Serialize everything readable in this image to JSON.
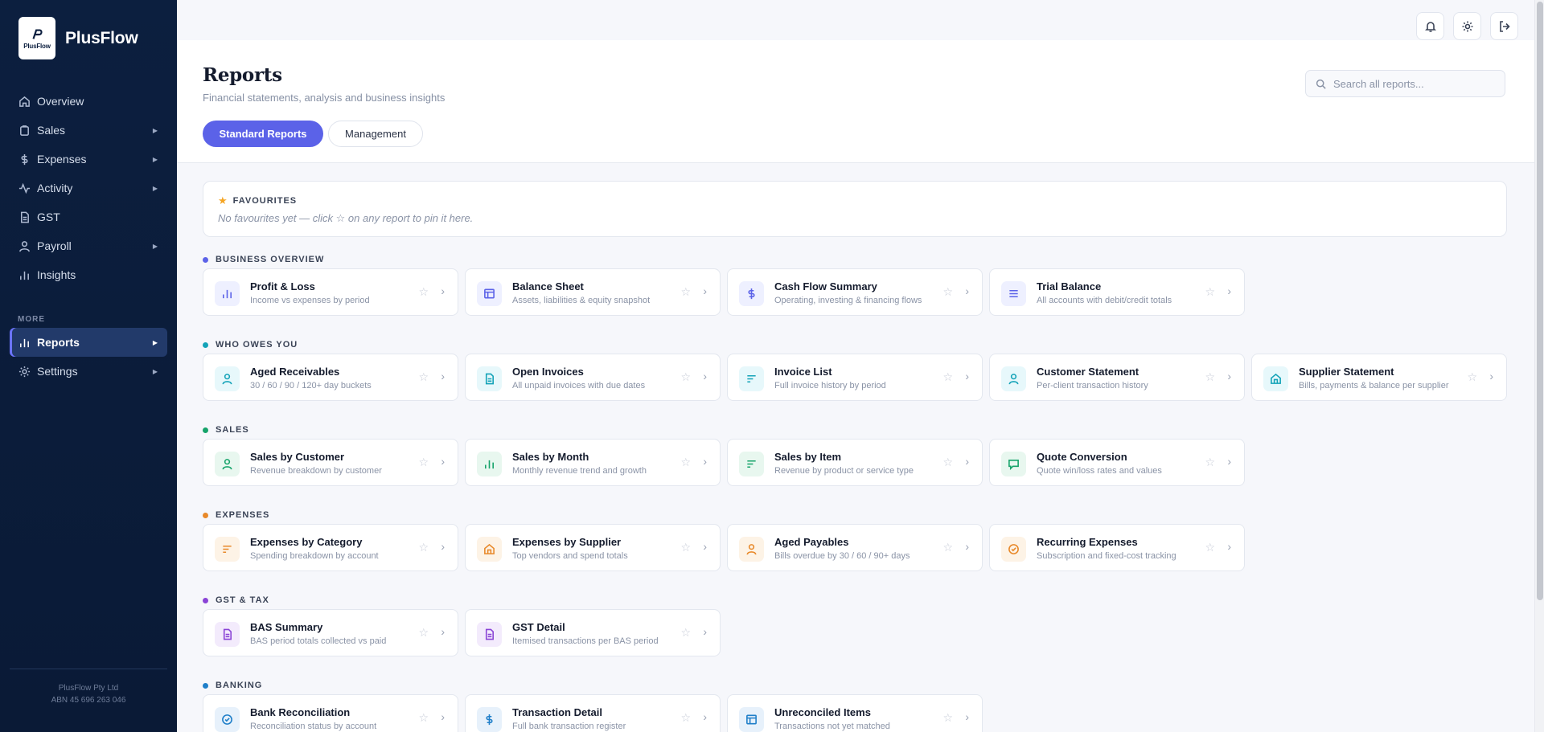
{
  "app": {
    "name": "PlusFlow",
    "logo_text": "PlusFlow",
    "company_name": "PlusFlow Pty Ltd",
    "abn": "ABN 45 696 263 046"
  },
  "sidebar": {
    "items": [
      {
        "label": "Overview",
        "icon": "home-icon"
      },
      {
        "label": "Sales",
        "icon": "clipboard-icon"
      },
      {
        "label": "Expenses",
        "icon": "dollar-icon"
      },
      {
        "label": "Activity",
        "icon": "activity-icon"
      },
      {
        "label": "GST",
        "icon": "document-icon"
      },
      {
        "label": "Payroll",
        "icon": "person-icon"
      },
      {
        "label": "Insights",
        "icon": "bar-chart-icon"
      }
    ],
    "more_label": "MORE",
    "more_items": [
      {
        "label": "Reports",
        "icon": "bar-chart-icon",
        "active": true
      },
      {
        "label": "Settings",
        "icon": "gear-icon"
      }
    ]
  },
  "header": {
    "title": "Reports",
    "subtitle": "Financial statements, analysis and business insights",
    "tabs": [
      {
        "label": "Standard Reports",
        "active": true
      },
      {
        "label": "Management",
        "active": false
      }
    ],
    "search_placeholder": "Search all reports..."
  },
  "favourites": {
    "title": "FAVOURITES",
    "empty_text": "No favourites yet — click ☆ on any report to pin it here."
  },
  "sections": [
    {
      "label": "BUSINESS OVERVIEW",
      "color": "#5b62e8",
      "cards": [
        {
          "title": "Profit & Loss",
          "desc": "Income vs expenses by period",
          "icon": "bar-chart-icon"
        },
        {
          "title": "Balance Sheet",
          "desc": "Assets, liabilities & equity snapshot",
          "icon": "table-icon"
        },
        {
          "title": "Cash Flow Summary",
          "desc": "Operating, investing & financing flows",
          "icon": "dollar-icon"
        },
        {
          "title": "Trial Balance",
          "desc": "All accounts with debit/credit totals",
          "icon": "list-icon"
        }
      ]
    },
    {
      "label": "WHO OWES YOU",
      "color": "#14a3b8",
      "cards": [
        {
          "title": "Aged Receivables",
          "desc": "30 / 60 / 90 / 120+ day buckets",
          "icon": "person-icon"
        },
        {
          "title": "Open Invoices",
          "desc": "All unpaid invoices with due dates",
          "icon": "document-icon"
        },
        {
          "title": "Invoice List",
          "desc": "Full invoice history by period",
          "icon": "sort-icon"
        },
        {
          "title": "Customer Statement",
          "desc": "Per-client transaction history",
          "icon": "person-icon"
        },
        {
          "title": "Supplier Statement",
          "desc": "Bills, payments & balance per supplier",
          "icon": "building-icon"
        }
      ]
    },
    {
      "label": "SALES",
      "color": "#16a36a",
      "cards": [
        {
          "title": "Sales by Customer",
          "desc": "Revenue breakdown by customer",
          "icon": "person-icon"
        },
        {
          "title": "Sales by Month",
          "desc": "Monthly revenue trend and growth",
          "icon": "bar-chart-icon"
        },
        {
          "title": "Sales by Item",
          "desc": "Revenue by product or service type",
          "icon": "sort-icon"
        },
        {
          "title": "Quote Conversion",
          "desc": "Quote win/loss rates and values",
          "icon": "chat-icon"
        }
      ]
    },
    {
      "label": "EXPENSES",
      "color": "#e8892a",
      "cards": [
        {
          "title": "Expenses by Category",
          "desc": "Spending breakdown by account",
          "icon": "sort-icon"
        },
        {
          "title": "Expenses by Supplier",
          "desc": "Top vendors and spend totals",
          "icon": "building-icon"
        },
        {
          "title": "Aged Payables",
          "desc": "Bills overdue by 30 / 60 / 90+ days",
          "icon": "person-icon"
        },
        {
          "title": "Recurring Expenses",
          "desc": "Subscription and fixed-cost tracking",
          "icon": "check-circle-icon"
        }
      ]
    },
    {
      "label": "GST & TAX",
      "color": "#8a44d6",
      "cards": [
        {
          "title": "BAS Summary",
          "desc": "BAS period totals collected vs paid",
          "icon": "document-icon"
        },
        {
          "title": "GST Detail",
          "desc": "Itemised transactions per BAS period",
          "icon": "document-icon"
        }
      ]
    },
    {
      "label": "BANKING",
      "color": "#1f7fc9",
      "cards": [
        {
          "title": "Bank Reconciliation",
          "desc": "Reconciliation status by account",
          "icon": "check-circle-icon"
        },
        {
          "title": "Transaction Detail",
          "desc": "Full bank transaction register",
          "icon": "dollar-icon"
        },
        {
          "title": "Unreconciled Items",
          "desc": "Transactions not yet matched",
          "icon": "table-icon"
        }
      ]
    }
  ]
}
